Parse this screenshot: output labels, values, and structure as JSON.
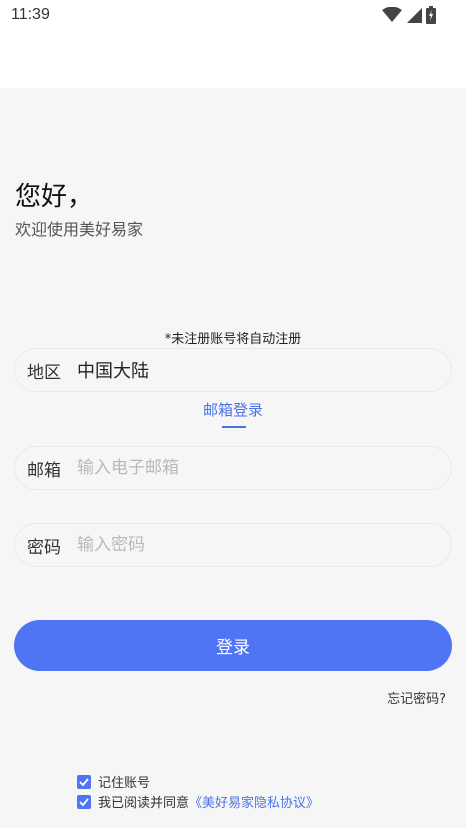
{
  "status_bar": {
    "time": "11:39"
  },
  "greeting": {
    "title": "您好，",
    "subtitle": "欢迎使用美好易家"
  },
  "hint": "*未注册账号将自动注册",
  "region": {
    "label": "地区",
    "value": "中国大陆"
  },
  "tabs": {
    "email_login": "邮箱登录"
  },
  "email": {
    "label": "邮箱",
    "placeholder": "输入电子邮箱"
  },
  "password": {
    "label": "密码",
    "placeholder": "输入密码"
  },
  "login_button": "登录",
  "forgot_password": "忘记密码?",
  "remember": {
    "label": "记住账号",
    "checked": true
  },
  "agreement": {
    "prefix": "我已阅读并同意",
    "link": "《美好易家隐私协议》",
    "checked": true
  },
  "colors": {
    "accent": "#4f75f4",
    "link": "#4a74e6",
    "background": "#f6f6f6"
  }
}
